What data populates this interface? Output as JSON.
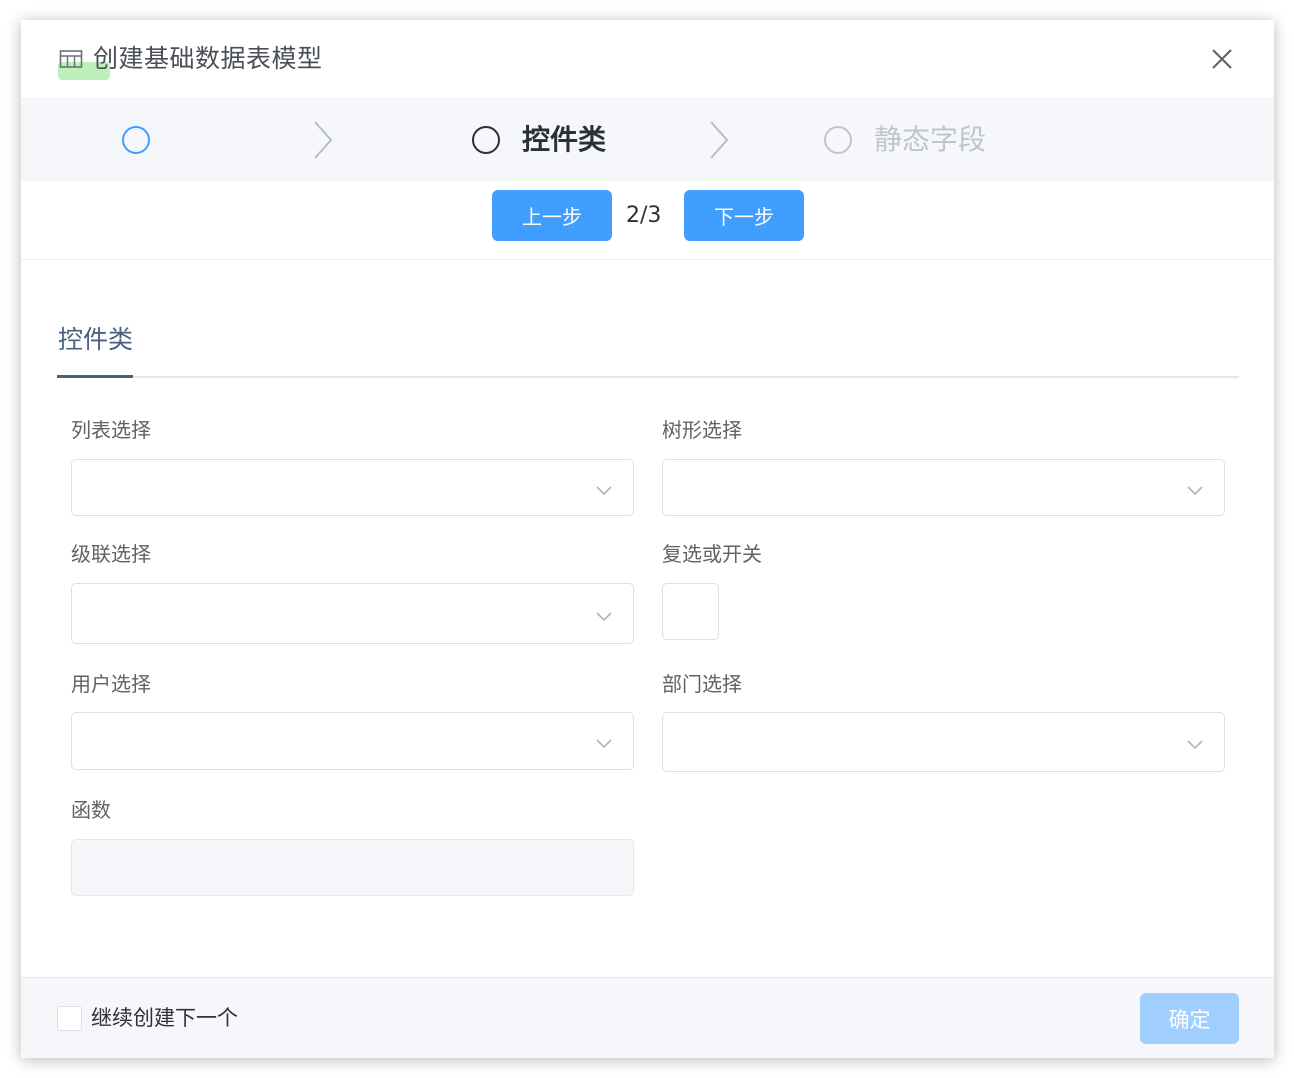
{
  "dialog": {
    "title": "创建基础数据表模型",
    "title_icon": "table-icon",
    "close_icon": "close-icon"
  },
  "steps": {
    "items": [
      {
        "label": "",
        "state": "done"
      },
      {
        "label": "控件类",
        "state": "current"
      },
      {
        "label": "静态字段",
        "state": "pending"
      }
    ],
    "separator_icon": "chevron-right-icon"
  },
  "pager": {
    "prev_label": "上一步",
    "indicator": "2/3",
    "next_label": "下一步"
  },
  "tabs": {
    "active": "控件类"
  },
  "form": {
    "list_select": {
      "label": "列表选择",
      "value": ""
    },
    "tree_select": {
      "label": "树形选择",
      "value": ""
    },
    "cascade_select": {
      "label": "级联选择",
      "value": ""
    },
    "checkbox_switch": {
      "label": "复选或开关"
    },
    "user_select": {
      "label": "用户选择",
      "value": ""
    },
    "dept_select": {
      "label": "部门选择",
      "value": ""
    },
    "function": {
      "label": "函数",
      "value": ""
    }
  },
  "footer": {
    "continue_label": "继续创建下一个",
    "confirm_label": "确定"
  },
  "colors": {
    "primary": "#409eff",
    "primary_disabled": "#a0cfff",
    "tab_active": "#4a6080",
    "step_pending": "#c0c4cc"
  }
}
